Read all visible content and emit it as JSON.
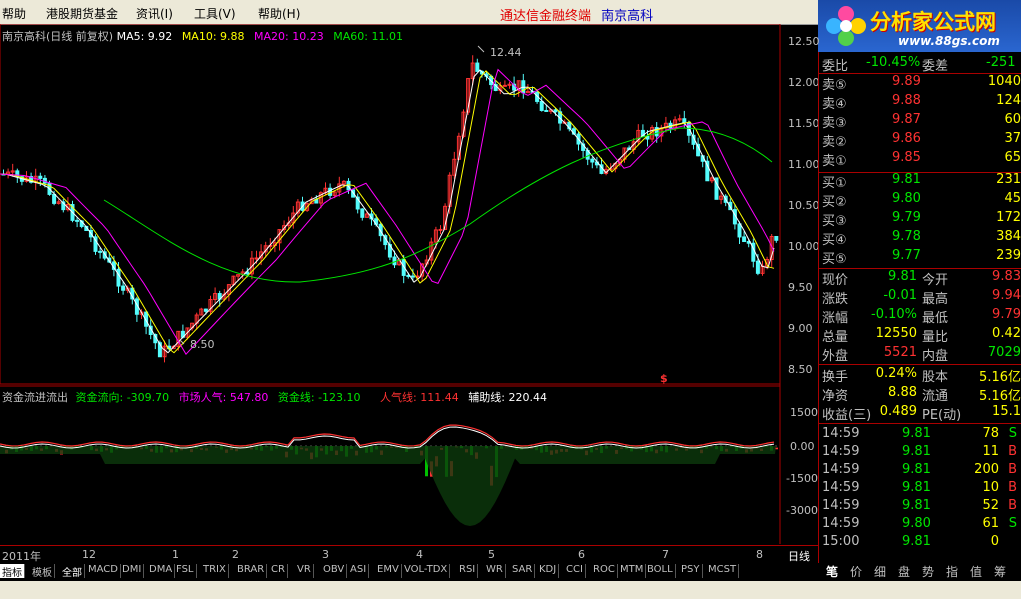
{
  "menu": [
    "帮助",
    "港股期货基金",
    "资讯(I)",
    "工具(V)",
    "帮助(H)"
  ],
  "app_title": "通达信金融终端",
  "stock_name": "南京高科",
  "logo": {
    "main": "分析家公式网",
    "url": "www.88gs.com"
  },
  "main_header": {
    "label": "南京高科(日线 前复权)",
    "ma5": "MA5: 9.92",
    "ma10": "MA10: 9.88",
    "ma20": "MA20: 10.23",
    "ma60": "MA60: 11.01"
  },
  "sub_header": {
    "label": "资金流进流出",
    "v1": "资金流向: -309.70",
    "v2": "市场人气: 547.80",
    "v3": "资金线: -123.10",
    "v4": "人气线: 111.44",
    "v5": "辅助线: 220.44"
  },
  "annotations": {
    "high": "12.44",
    "low": "8.50"
  },
  "price_axis": [
    "12.50",
    "12.00",
    "11.50",
    "11.00",
    "10.50",
    "10.00",
    "9.50",
    "9.00",
    "8.50"
  ],
  "sub_axis": [
    "1500",
    "0.00",
    "-1500",
    "-3000"
  ],
  "date_axis": [
    "2011年",
    "12",
    "1",
    "2",
    "3",
    "4",
    "5",
    "6",
    "7",
    "8"
  ],
  "period_label": "日线",
  "colors": {
    "up": "#ff3232",
    "down": "#54fcfc",
    "ma5": "#ffffff",
    "ma10": "#ffff00",
    "ma20": "#ff00ff",
    "ma60": "#00e600",
    "bg": "#000000",
    "grid": "#aa0000"
  },
  "quote": {
    "weibi": {
      "label": "委比",
      "value": "-10.45%"
    },
    "weicha": {
      "label": "委差",
      "value": "-251"
    },
    "sell": [
      {
        "label": "卖⑤",
        "price": "9.89",
        "vol": "1040"
      },
      {
        "label": "卖④",
        "price": "9.88",
        "vol": "124"
      },
      {
        "label": "卖③",
        "price": "9.87",
        "vol": "60"
      },
      {
        "label": "卖②",
        "price": "9.86",
        "vol": "37"
      },
      {
        "label": "卖①",
        "price": "9.85",
        "vol": "65"
      }
    ],
    "buy": [
      {
        "label": "买①",
        "price": "9.81",
        "vol": "231"
      },
      {
        "label": "买②",
        "price": "9.80",
        "vol": "45"
      },
      {
        "label": "买③",
        "price": "9.79",
        "vol": "172"
      },
      {
        "label": "买④",
        "price": "9.78",
        "vol": "384"
      },
      {
        "label": "买⑤",
        "price": "9.77",
        "vol": "239"
      }
    ],
    "stats": [
      {
        "l1": "现价",
        "v1": "9.81",
        "l2": "今开",
        "v2": "9.83"
      },
      {
        "l1": "涨跌",
        "v1": "-0.01",
        "l2": "最高",
        "v2": "9.94"
      },
      {
        "l1": "涨幅",
        "v1": "-0.10%",
        "l2": "最低",
        "v2": "9.79"
      },
      {
        "l1": "总量",
        "v1": "12550",
        "l2": "量比",
        "v2": "0.42"
      },
      {
        "l1": "外盘",
        "v1": "5521",
        "l2": "内盘",
        "v2": "7029"
      }
    ],
    "stats2": [
      {
        "l1": "换手",
        "v1": "0.24%",
        "l2": "股本",
        "v2": "5.16亿"
      },
      {
        "l1": "净资",
        "v1": "8.88",
        "l2": "流通",
        "v2": "5.16亿"
      },
      {
        "l1": "收益(三)",
        "v1": "0.489",
        "l2": "PE(动)",
        "v2": "15.1"
      }
    ],
    "ticks": [
      {
        "time": "14:59",
        "price": "9.81",
        "vol": "78",
        "side": "S"
      },
      {
        "time": "14:59",
        "price": "9.81",
        "vol": "11",
        "side": "B"
      },
      {
        "time": "14:59",
        "price": "9.81",
        "vol": "200",
        "side": "B"
      },
      {
        "time": "14:59",
        "price": "9.81",
        "vol": "10",
        "side": "B"
      },
      {
        "time": "14:59",
        "price": "9.81",
        "vol": "52",
        "side": "B"
      },
      {
        "time": "14:59",
        "price": "9.80",
        "vol": "61",
        "side": "S"
      },
      {
        "time": "15:00",
        "price": "9.81",
        "vol": "0",
        "side": ""
      }
    ]
  },
  "bottom_tabs": [
    "指标",
    "模板",
    "全部",
    "MACD",
    "DMI",
    "DMA",
    "FSL",
    "TRIX",
    "BRAR",
    "CR",
    "VR",
    "OBV",
    "ASI",
    "EMV",
    "VOL-TDX",
    "RSI",
    "WR",
    "SAR",
    "KDJ",
    "CCI",
    "ROC",
    "MTM",
    "BOLL",
    "PSY",
    "MCST"
  ],
  "right_tabs": [
    "笔",
    "价",
    "细",
    "盘",
    "势",
    "指",
    "值",
    "筹"
  ]
}
